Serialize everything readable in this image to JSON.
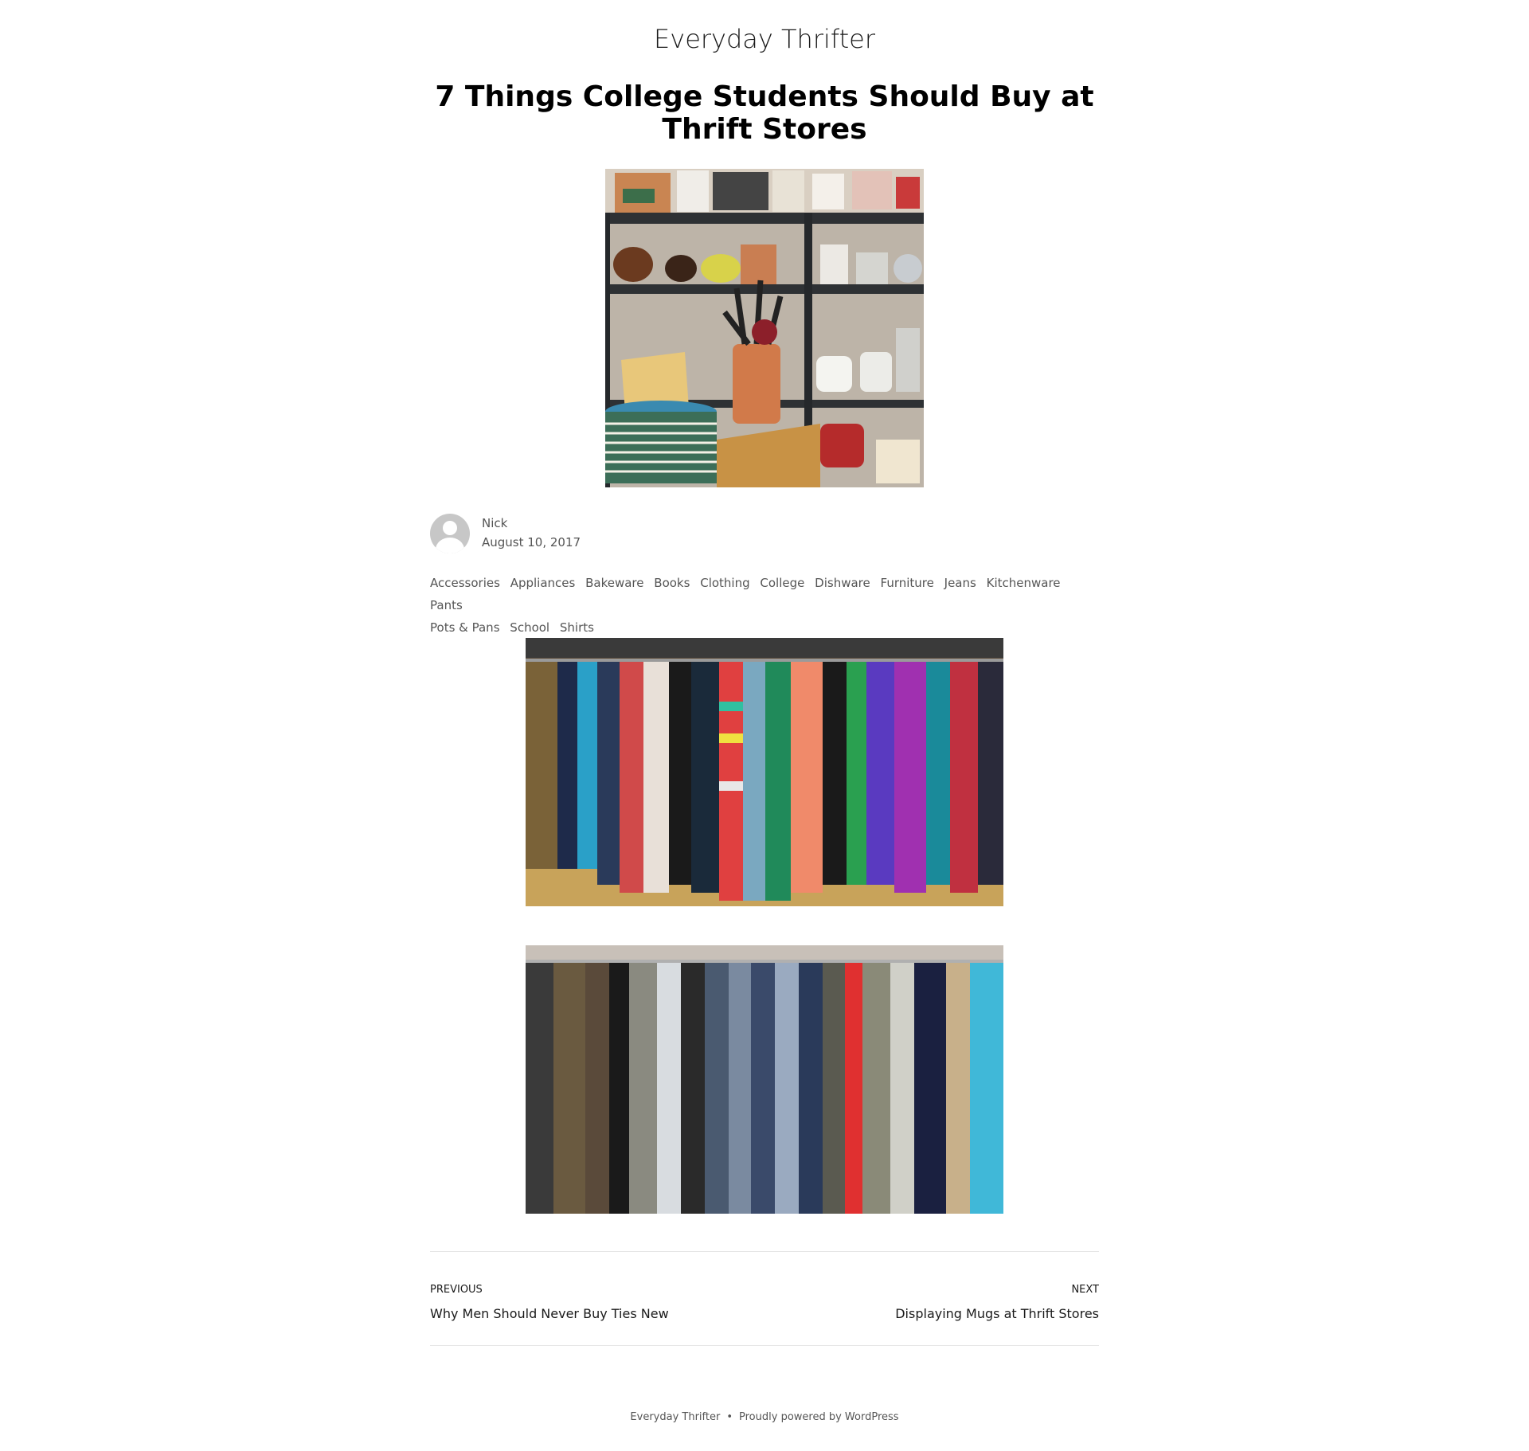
{
  "site": {
    "title": "Everyday Thrifter"
  },
  "post": {
    "title": "7 Things College Students Should Buy at Thrift Stores",
    "author": "Nick",
    "date": "August 10, 2017",
    "tags": [
      "Accessories",
      "Appliances",
      "Bakeware",
      "Books",
      "Clothing",
      "College",
      "Dishware",
      "Furniture",
      "Jeans",
      "Kitchenware",
      "Pants",
      "Pots & Pans",
      "School",
      "Shirts"
    ]
  },
  "nav": {
    "previous_label": "Previous",
    "previous_title": "Why Men Should Never Buy Ties New",
    "next_label": "Next",
    "next_title": "Displaying Mugs at Thrift Stores"
  },
  "footer": {
    "site_name": "Everyday Thrifter",
    "separator": "•",
    "powered": "Proudly powered by WordPress"
  },
  "colors": {
    "text": "#1a1a1a",
    "meta": "#555555",
    "border": "#e6e6e6"
  }
}
